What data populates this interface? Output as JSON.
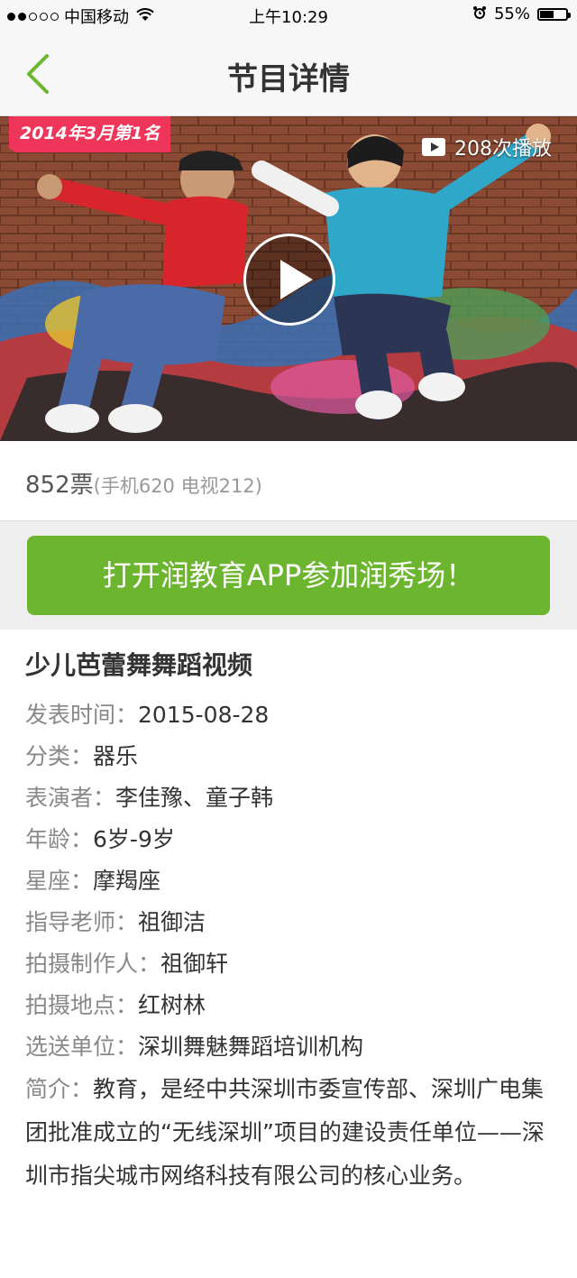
{
  "status_bar": {
    "carrier": "中国移动",
    "time": "上午10:29",
    "battery": "55%",
    "battery_level": 0.55,
    "icons": [
      "signal-dots",
      "wifi-icon",
      "alarm-icon",
      "battery-icon"
    ]
  },
  "nav": {
    "title": "节目详情",
    "back_icon": "chevron-left-icon",
    "accent_color": "#6cb52f"
  },
  "video": {
    "rank_badge": "2014年3月第1名",
    "play_count": "208次播放",
    "play_icon": "play-icon"
  },
  "votes": {
    "total": "852票",
    "breakdown": "(手机620 电视212)"
  },
  "cta": {
    "label": "打开润教育APP参加润秀场！",
    "color": "#6cb52f"
  },
  "details": {
    "title": "少儿芭蕾舞舞蹈视频",
    "fields": [
      {
        "label": "发表时间：",
        "value": "2015-08-28"
      },
      {
        "label": "分类：",
        "value": "器乐"
      },
      {
        "label": "表演者：",
        "value": "李佳豫、童子韩"
      },
      {
        "label": "年龄：",
        "value": "6岁-9岁"
      },
      {
        "label": "星座：",
        "value": "摩羯座"
      },
      {
        "label": "指导老师：",
        "value": "祖御洁"
      },
      {
        "label": "拍摄制作人：",
        "value": "祖御轩"
      },
      {
        "label": "拍摄地点：",
        "value": "红树林"
      },
      {
        "label": "选送单位：",
        "value": "深圳舞魅舞蹈培训机构"
      }
    ],
    "intro_label": "简介：",
    "intro_text": "教育，是经中共深圳市委宣传部、深圳广电集团批准成立的“无线深圳”项目的建设责任单位——深圳市指尖城市网络科技有限公司的核心业务。"
  }
}
